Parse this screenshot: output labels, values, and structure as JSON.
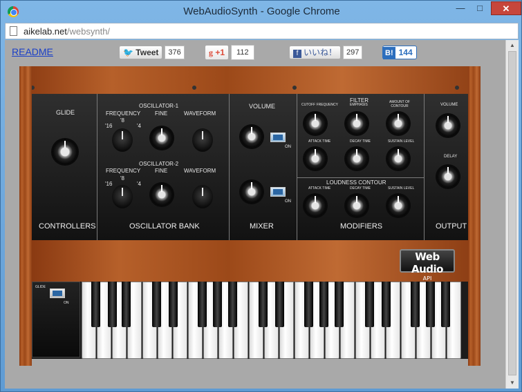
{
  "window": {
    "title": "WebAudioSynth - Google Chrome",
    "min": "—",
    "max": "□",
    "close": "✕"
  },
  "address": {
    "host": "aikelab.net",
    "path": "/websynth/"
  },
  "page": {
    "readme": "README",
    "social": {
      "tweet_label": "Tweet",
      "tweet_count": "376",
      "gplus_label": "+1",
      "gplus_count": "112",
      "fb_label": "いいね！",
      "fb_count": "297",
      "hatena_label": "B!",
      "hatena_count": "144"
    }
  },
  "synth": {
    "controllers": {
      "section": "CONTROLLERS",
      "glide": "GLIDE"
    },
    "osc_bank": {
      "section": "OSCILLATOR BANK",
      "osc1": "OSCILLATOR-1",
      "osc2": "OSCILLATOR-2",
      "frequency": "FREQUENCY",
      "fine": "FINE",
      "waveform": "WAVEFORM",
      "r16": "'16",
      "r8": "'8",
      "r4": "'4"
    },
    "mixer": {
      "section": "MIXER",
      "volume": "VOLUME",
      "on": "ON"
    },
    "modifiers": {
      "section": "MODIFIERS",
      "filter": "FILTER",
      "cutoff": "CUTOFF FREQUENCY",
      "emphasis": "EMPHASIS",
      "amount": "AMOUNT OF CONTOUR",
      "attack": "ATTACK TIME",
      "decay": "DECAY TIME",
      "sustain": "SUSTAIN LEVEL",
      "loudness": "LOUDNESS CONTOUR"
    },
    "output": {
      "section": "OUTPUT",
      "volume": "VOLUME",
      "delay": "DELAY"
    },
    "badge": {
      "title": "Web Audio",
      "sub": "API"
    },
    "glide_switch": {
      "label": "GLIDE",
      "on": "ON"
    }
  }
}
